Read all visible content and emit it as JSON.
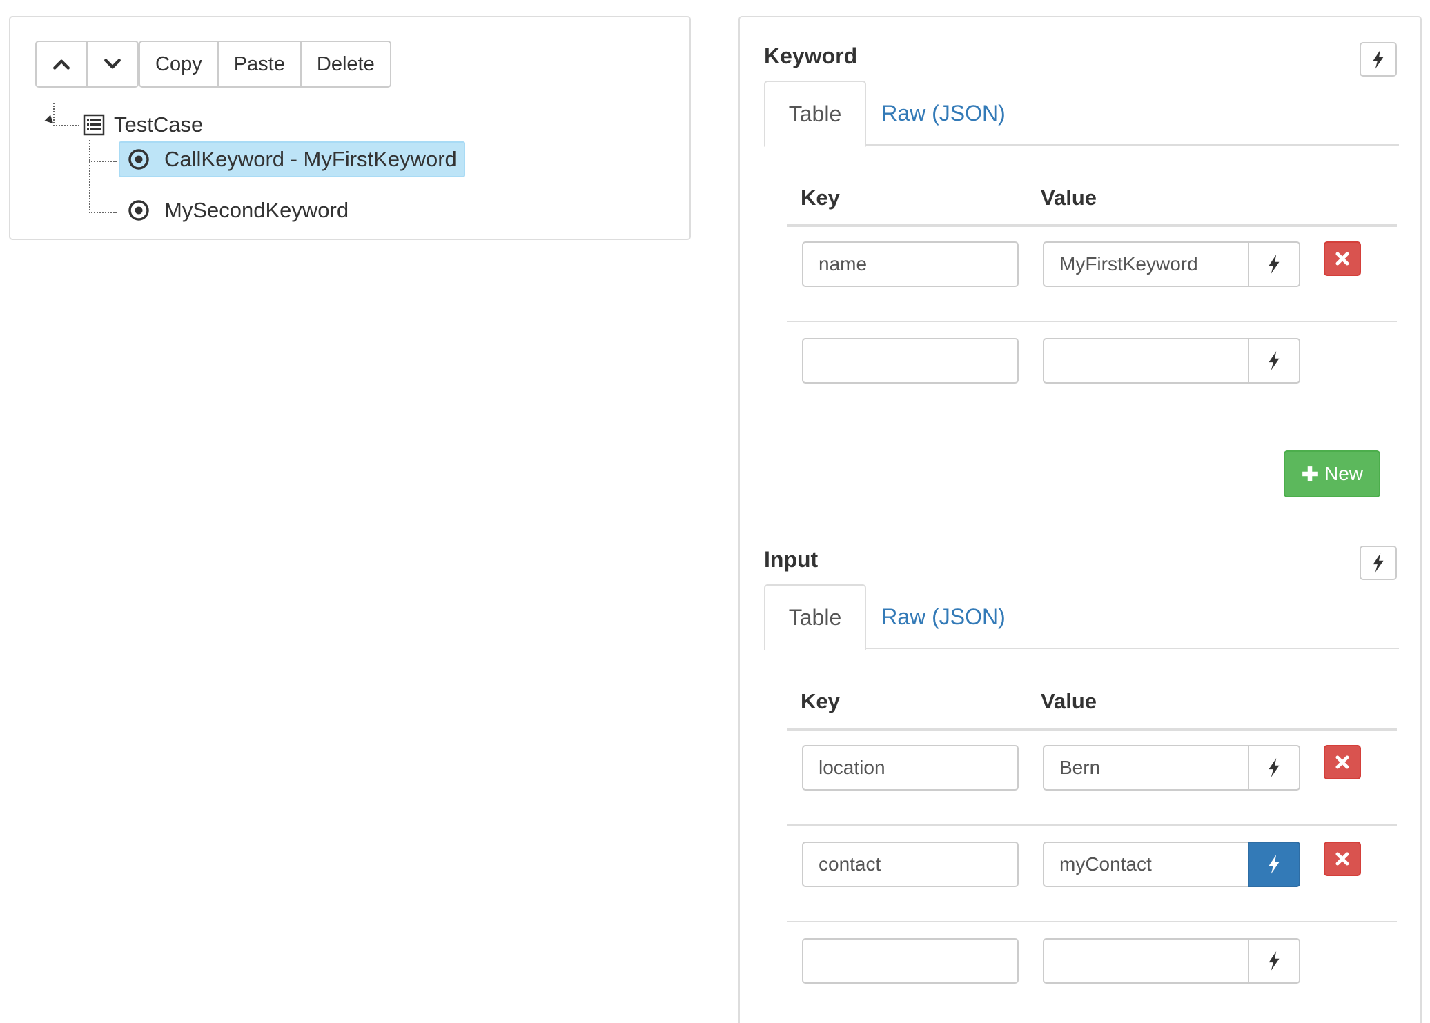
{
  "toolbar": {
    "up_icon": "chevron-up-icon",
    "down_icon": "chevron-down-icon",
    "copy_label": "Copy",
    "paste_label": "Paste",
    "delete_label": "Delete"
  },
  "tree": {
    "root": {
      "label": "TestCase",
      "icon": "list-alt-icon"
    },
    "children": [
      {
        "label": "CallKeyword - MyFirstKeyword",
        "icon": "record-icon",
        "selected": true
      },
      {
        "label": "MySecondKeyword",
        "icon": "record-icon",
        "selected": false
      }
    ]
  },
  "keyword_section": {
    "title": "Keyword",
    "tabs": [
      {
        "label": "Table",
        "active": true
      },
      {
        "label": "Raw (JSON)",
        "active": false
      }
    ],
    "columns": {
      "key": "Key",
      "value": "Value"
    },
    "rows": [
      {
        "key": "name",
        "value": "MyFirstKeyword",
        "bound": false
      },
      {
        "key": "",
        "value": "",
        "bound": false
      }
    ],
    "new_label": "New"
  },
  "input_section": {
    "title": "Input",
    "tabs": [
      {
        "label": "Table",
        "active": true
      },
      {
        "label": "Raw (JSON)",
        "active": false
      }
    ],
    "columns": {
      "key": "Key",
      "value": "Value"
    },
    "rows": [
      {
        "key": "location",
        "value": "Bern",
        "bound": false
      },
      {
        "key": "contact",
        "value": "myContact",
        "bound": true
      },
      {
        "key": "",
        "value": "",
        "bound": false
      }
    ]
  },
  "colors": {
    "selected_bg": "#bde4f7",
    "link": "#337ab7",
    "danger": "#d9534f",
    "success": "#5cb85c",
    "primary": "#337ab7"
  }
}
